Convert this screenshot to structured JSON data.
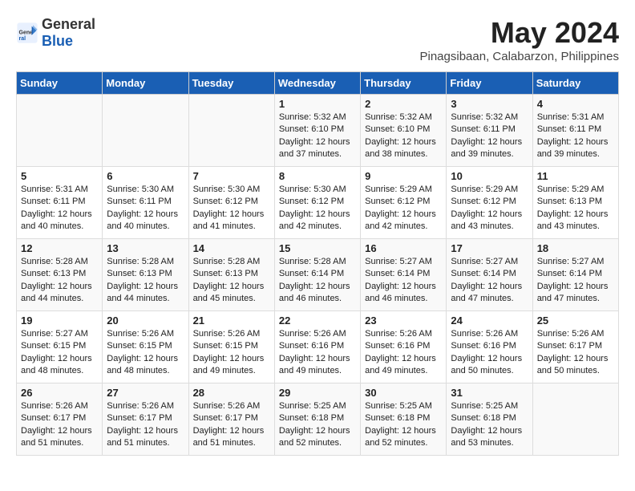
{
  "header": {
    "logo_general": "General",
    "logo_blue": "Blue",
    "month_year": "May 2024",
    "location": "Pinagsibaan, Calabarzon, Philippines"
  },
  "days_of_week": [
    "Sunday",
    "Monday",
    "Tuesday",
    "Wednesday",
    "Thursday",
    "Friday",
    "Saturday"
  ],
  "weeks": [
    [
      {
        "day": "",
        "content": ""
      },
      {
        "day": "",
        "content": ""
      },
      {
        "day": "",
        "content": ""
      },
      {
        "day": "1",
        "content": "Sunrise: 5:32 AM\nSunset: 6:10 PM\nDaylight: 12 hours\nand 37 minutes."
      },
      {
        "day": "2",
        "content": "Sunrise: 5:32 AM\nSunset: 6:10 PM\nDaylight: 12 hours\nand 38 minutes."
      },
      {
        "day": "3",
        "content": "Sunrise: 5:32 AM\nSunset: 6:11 PM\nDaylight: 12 hours\nand 39 minutes."
      },
      {
        "day": "4",
        "content": "Sunrise: 5:31 AM\nSunset: 6:11 PM\nDaylight: 12 hours\nand 39 minutes."
      }
    ],
    [
      {
        "day": "5",
        "content": "Sunrise: 5:31 AM\nSunset: 6:11 PM\nDaylight: 12 hours\nand 40 minutes."
      },
      {
        "day": "6",
        "content": "Sunrise: 5:30 AM\nSunset: 6:11 PM\nDaylight: 12 hours\nand 40 minutes."
      },
      {
        "day": "7",
        "content": "Sunrise: 5:30 AM\nSunset: 6:12 PM\nDaylight: 12 hours\nand 41 minutes."
      },
      {
        "day": "8",
        "content": "Sunrise: 5:30 AM\nSunset: 6:12 PM\nDaylight: 12 hours\nand 42 minutes."
      },
      {
        "day": "9",
        "content": "Sunrise: 5:29 AM\nSunset: 6:12 PM\nDaylight: 12 hours\nand 42 minutes."
      },
      {
        "day": "10",
        "content": "Sunrise: 5:29 AM\nSunset: 6:12 PM\nDaylight: 12 hours\nand 43 minutes."
      },
      {
        "day": "11",
        "content": "Sunrise: 5:29 AM\nSunset: 6:13 PM\nDaylight: 12 hours\nand 43 minutes."
      }
    ],
    [
      {
        "day": "12",
        "content": "Sunrise: 5:28 AM\nSunset: 6:13 PM\nDaylight: 12 hours\nand 44 minutes."
      },
      {
        "day": "13",
        "content": "Sunrise: 5:28 AM\nSunset: 6:13 PM\nDaylight: 12 hours\nand 44 minutes."
      },
      {
        "day": "14",
        "content": "Sunrise: 5:28 AM\nSunset: 6:13 PM\nDaylight: 12 hours\nand 45 minutes."
      },
      {
        "day": "15",
        "content": "Sunrise: 5:28 AM\nSunset: 6:14 PM\nDaylight: 12 hours\nand 46 minutes."
      },
      {
        "day": "16",
        "content": "Sunrise: 5:27 AM\nSunset: 6:14 PM\nDaylight: 12 hours\nand 46 minutes."
      },
      {
        "day": "17",
        "content": "Sunrise: 5:27 AM\nSunset: 6:14 PM\nDaylight: 12 hours\nand 47 minutes."
      },
      {
        "day": "18",
        "content": "Sunrise: 5:27 AM\nSunset: 6:14 PM\nDaylight: 12 hours\nand 47 minutes."
      }
    ],
    [
      {
        "day": "19",
        "content": "Sunrise: 5:27 AM\nSunset: 6:15 PM\nDaylight: 12 hours\nand 48 minutes."
      },
      {
        "day": "20",
        "content": "Sunrise: 5:26 AM\nSunset: 6:15 PM\nDaylight: 12 hours\nand 48 minutes."
      },
      {
        "day": "21",
        "content": "Sunrise: 5:26 AM\nSunset: 6:15 PM\nDaylight: 12 hours\nand 49 minutes."
      },
      {
        "day": "22",
        "content": "Sunrise: 5:26 AM\nSunset: 6:16 PM\nDaylight: 12 hours\nand 49 minutes."
      },
      {
        "day": "23",
        "content": "Sunrise: 5:26 AM\nSunset: 6:16 PM\nDaylight: 12 hours\nand 49 minutes."
      },
      {
        "day": "24",
        "content": "Sunrise: 5:26 AM\nSunset: 6:16 PM\nDaylight: 12 hours\nand 50 minutes."
      },
      {
        "day": "25",
        "content": "Sunrise: 5:26 AM\nSunset: 6:17 PM\nDaylight: 12 hours\nand 50 minutes."
      }
    ],
    [
      {
        "day": "26",
        "content": "Sunrise: 5:26 AM\nSunset: 6:17 PM\nDaylight: 12 hours\nand 51 minutes."
      },
      {
        "day": "27",
        "content": "Sunrise: 5:26 AM\nSunset: 6:17 PM\nDaylight: 12 hours\nand 51 minutes."
      },
      {
        "day": "28",
        "content": "Sunrise: 5:26 AM\nSunset: 6:17 PM\nDaylight: 12 hours\nand 51 minutes."
      },
      {
        "day": "29",
        "content": "Sunrise: 5:25 AM\nSunset: 6:18 PM\nDaylight: 12 hours\nand 52 minutes."
      },
      {
        "day": "30",
        "content": "Sunrise: 5:25 AM\nSunset: 6:18 PM\nDaylight: 12 hours\nand 52 minutes."
      },
      {
        "day": "31",
        "content": "Sunrise: 5:25 AM\nSunset: 6:18 PM\nDaylight: 12 hours\nand 53 minutes."
      },
      {
        "day": "",
        "content": ""
      }
    ]
  ]
}
